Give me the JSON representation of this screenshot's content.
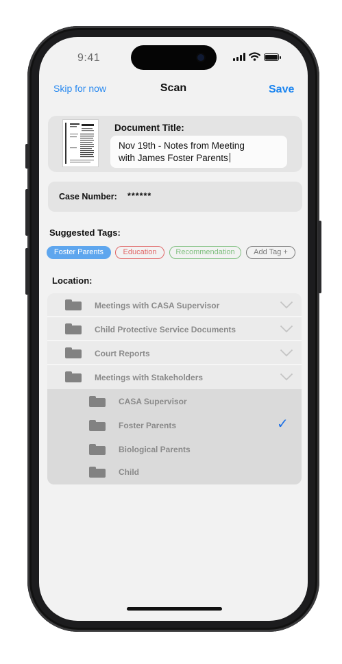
{
  "status_bar": {
    "time": "9:41"
  },
  "nav": {
    "skip": "Skip for now",
    "title": "Scan",
    "save": "Save"
  },
  "document": {
    "label": "Document Title:",
    "value_line1": "Nov 19th - Notes from Meeting",
    "value_line2": "with James Foster Parents"
  },
  "case": {
    "label": "Case Number:",
    "value": "******"
  },
  "tags": {
    "label": "Suggested Tags:",
    "items": [
      {
        "label": "Foster Parents",
        "style": "selected",
        "color": "#5ea6ee"
      },
      {
        "label": "Education",
        "style": "outline",
        "color": "#e06666"
      },
      {
        "label": "Recommendation",
        "style": "outline",
        "color": "#7fbf7f"
      },
      {
        "label": "Add Tag +",
        "style": "outline",
        "color": "#7a7a7a"
      }
    ]
  },
  "location": {
    "label": "Location:",
    "folders": [
      {
        "label": "Meetings with CASA Supervisor",
        "icon": "folder-icon",
        "expand_icon": "chevron-down-icon"
      },
      {
        "label": "Child Protective Service Documents",
        "icon": "folder-icon",
        "expand_icon": "chevron-down-icon"
      },
      {
        "label": "Court Reports",
        "icon": "folder-icon",
        "expand_icon": "chevron-down-icon"
      },
      {
        "label": "Meetings with Stakeholders",
        "icon": "folder-icon",
        "expand_icon": "chevron-down-icon",
        "expanded": true
      }
    ],
    "subfolders": [
      {
        "label": "CASA Supervisor",
        "selected": false
      },
      {
        "label": "Foster Parents",
        "selected": true,
        "check": "✓"
      },
      {
        "label": "Biological Parents",
        "selected": false
      },
      {
        "label": "Child",
        "selected": false
      }
    ]
  },
  "colors": {
    "accent": "#1a84f0",
    "background": "#f2f2f2",
    "card": "#e4e4e4"
  }
}
